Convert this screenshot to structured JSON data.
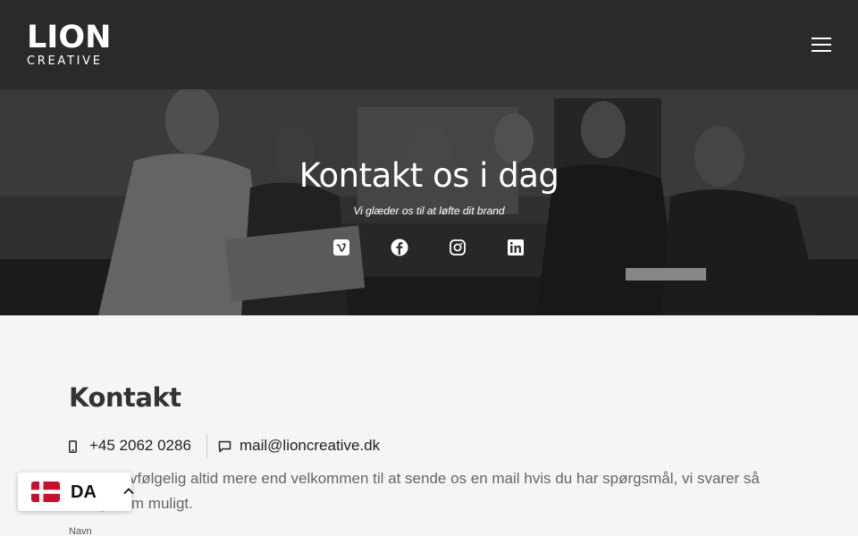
{
  "header": {
    "logo_main": "LION",
    "logo_sub": "CREATIVE"
  },
  "hero": {
    "title": "Kontakt os i dag",
    "subtitle": "Vi glæder os til at løfte dit brand",
    "social_icons": [
      "vimeo-icon",
      "facebook-icon",
      "instagram-icon",
      "linkedin-icon"
    ]
  },
  "contact": {
    "title": "Kontakt",
    "phone": "+45 2062 0286",
    "email": "mail@lioncreative.dk",
    "body": "Du er selvfølgelig altid mere end velkommen til at sende os en mail hvis du har spørgsmål, vi svarer så hurtigt som muligt.",
    "field_name_label": "Navn"
  },
  "language": {
    "code": "DA"
  },
  "colors": {
    "header_bg": "#2a2a2a",
    "page_bg": "#f5f5f5",
    "flag_red": "#c8102e"
  }
}
